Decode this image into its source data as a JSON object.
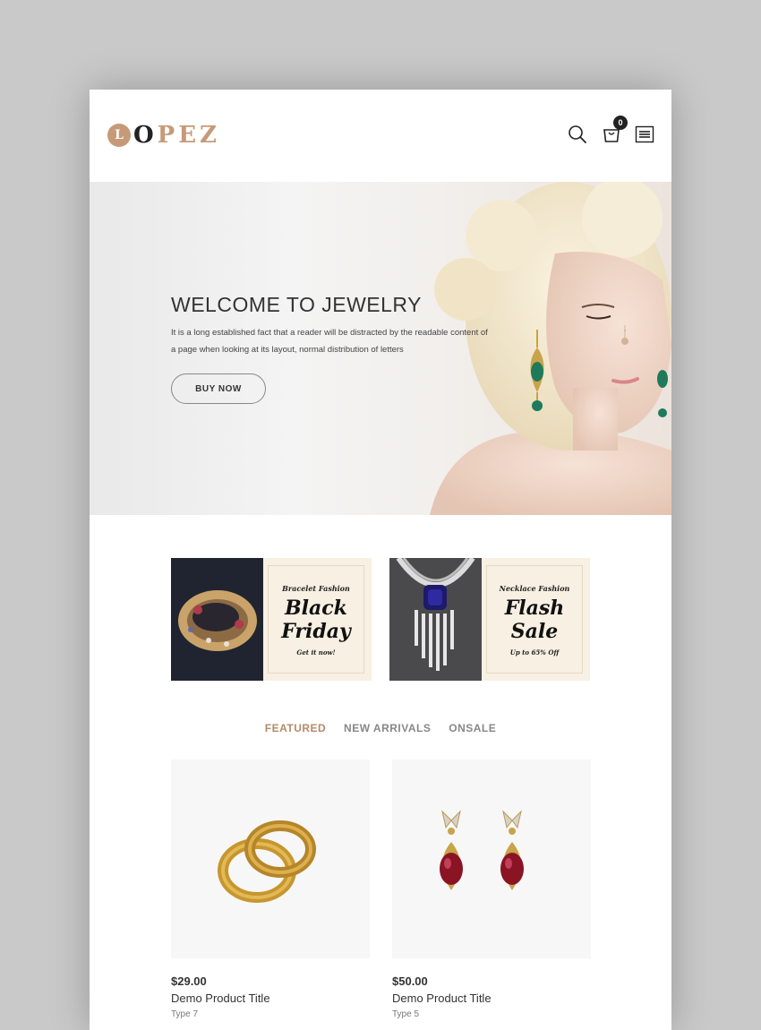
{
  "header": {
    "logo_mark": "L",
    "logo_first": "O",
    "logo_rest": "PEZ",
    "cart_count": "0",
    "icons": [
      "search-icon",
      "cart-icon",
      "menu-icon"
    ]
  },
  "hero": {
    "title": "WELCOME TO JEWELRY",
    "text": "It is a long established fact that a reader will be distracted by the readable content of a page when looking at its layout, normal distribution of letters",
    "button": "BUY NOW"
  },
  "banners": [
    {
      "small": "Bracelet Fashion",
      "big_1": "Black",
      "big_2": "Friday",
      "foot": "Get it now!"
    },
    {
      "small": "Necklace Fashion",
      "big_1": "Flash",
      "big_2": "Sale",
      "foot": "Up to 65% Off"
    }
  ],
  "tabs": [
    {
      "label": "FEATURED",
      "active": true
    },
    {
      "label": "NEW ARRIVALS",
      "active": false
    },
    {
      "label": "ONSALE",
      "active": false
    }
  ],
  "products": [
    {
      "price": "$29.00",
      "title": "Demo Product Title",
      "type": "Type 7"
    },
    {
      "price": "$50.00",
      "title": "Demo Product Title",
      "type": "Type 5"
    }
  ],
  "colors": {
    "accent": "#b68a68",
    "banner_bg": "#f8f0e3",
    "text": "#333333"
  }
}
